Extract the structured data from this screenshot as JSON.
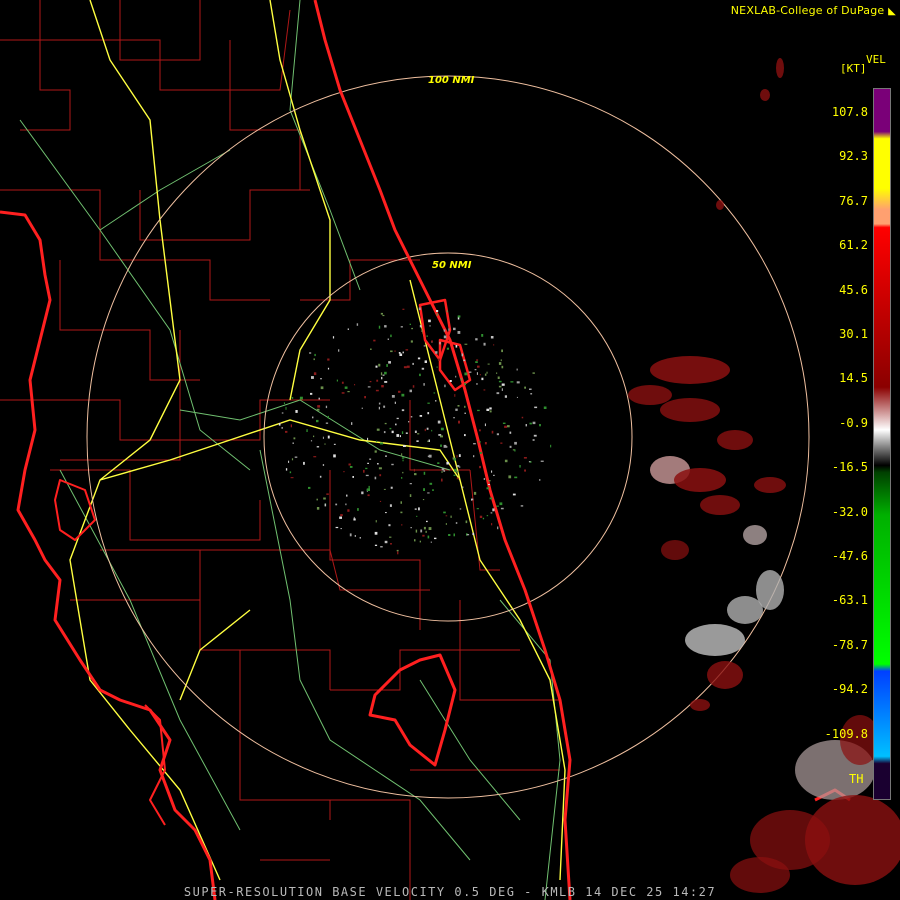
{
  "header": {
    "credit": "NEXLAB-College of DuPage"
  },
  "legend": {
    "product": "VEL",
    "unit": "[KT]",
    "ticks": [
      "107.8",
      "92.3",
      "76.7",
      "61.2",
      "45.6",
      "30.1",
      "14.5",
      "-0.9",
      "-16.5",
      "-32.0",
      "-47.6",
      "-63.1",
      "-78.7",
      "-94.2",
      "-109.8"
    ],
    "th_label": "TH",
    "colors": [
      "#7a0078",
      "#ffff00",
      "#ffa070",
      "#ff0000",
      "#8b0000",
      "#ffffff",
      "#00b000",
      "#00ff00",
      "#0040ff",
      "#00c0ff"
    ]
  },
  "range_rings": [
    {
      "label": "100 NMI",
      "radius_nmi": 100
    },
    {
      "label": "50 NMI",
      "radius_nmi": 50
    }
  ],
  "caption": "SUPER-RESOLUTION BASE VELOCITY 0.5 DEG - KMLB 14 DEC 25 14:27",
  "map_colors": {
    "coastline": "#ff2020",
    "county": "#b01818",
    "highway": "#ffff40",
    "road": "#70c070",
    "ring": "#f0c0a0"
  }
}
